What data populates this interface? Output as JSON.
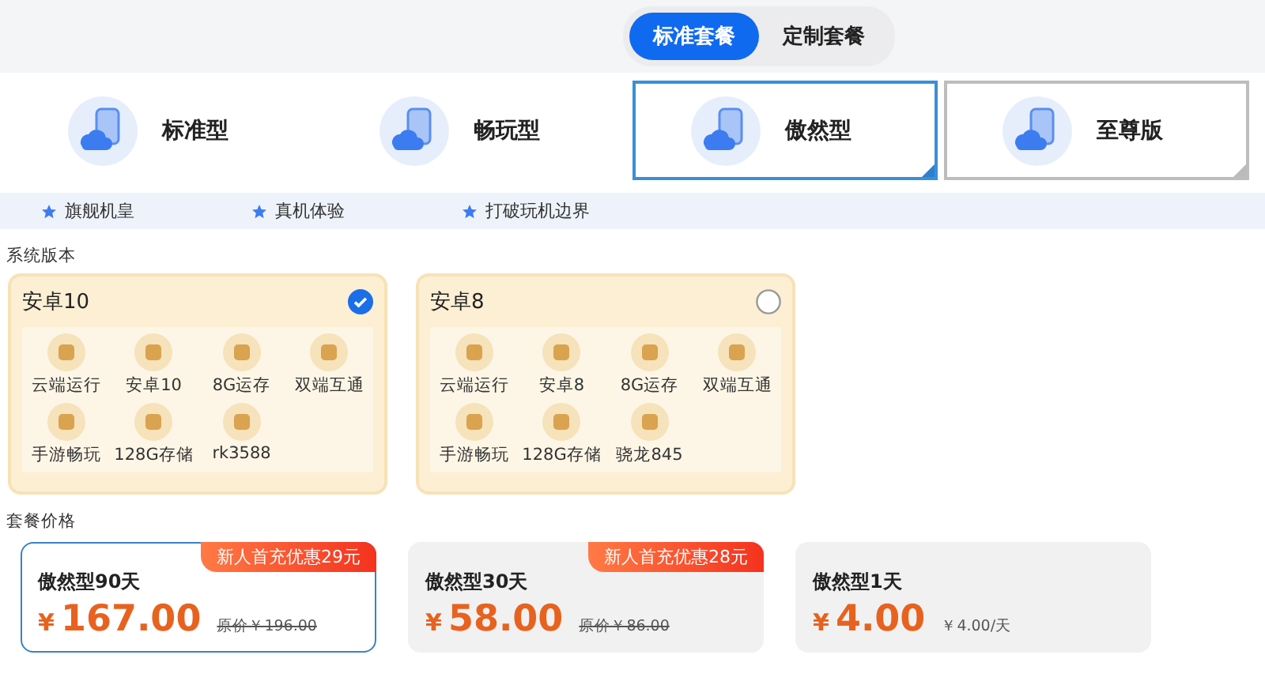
{
  "mode_tabs": [
    {
      "label": "标准套餐",
      "selected": true
    },
    {
      "label": "定制套餐",
      "selected": false
    }
  ],
  "tiers": [
    {
      "label": "标准型",
      "selected": false,
      "outlined": false
    },
    {
      "label": "畅玩型",
      "selected": false,
      "outlined": false
    },
    {
      "label": "傲然型",
      "selected": true
    },
    {
      "label": "至尊版",
      "selected": false,
      "outlined": true
    }
  ],
  "highlights": [
    "旗舰机皇",
    "真机体验",
    "打破玩机边界"
  ],
  "system_section": {
    "title": "系统版本",
    "versions": [
      {
        "name": "安卓10",
        "selected": true,
        "features": [
          "云端运行",
          "安卓10",
          "8G运存",
          "双端互通",
          "手游畅玩",
          "128G存储",
          "rk3588"
        ]
      },
      {
        "name": "安卓8",
        "selected": false,
        "features": [
          "云端运行",
          "安卓8",
          "8G运存",
          "双端互通",
          "手游畅玩",
          "128G存储",
          "骁龙845"
        ]
      }
    ]
  },
  "price_section": {
    "title": "套餐价格",
    "plans": [
      {
        "name": "傲然型90天",
        "price": "167.00",
        "currency": "¥",
        "badge": "新人首充优惠29元",
        "note": {
          "text": "原价￥196.00",
          "kind": "original"
        },
        "selected": true
      },
      {
        "name": "傲然型30天",
        "price": "58.00",
        "currency": "¥",
        "badge": "新人首充优惠28元",
        "note": {
          "text": "原价￥86.00",
          "kind": "original"
        },
        "selected": false
      },
      {
        "name": "傲然型1天",
        "price": "4.00",
        "currency": "¥",
        "note": {
          "text": "￥4.00/天",
          "kind": "per_day"
        },
        "selected": false
      }
    ]
  }
}
